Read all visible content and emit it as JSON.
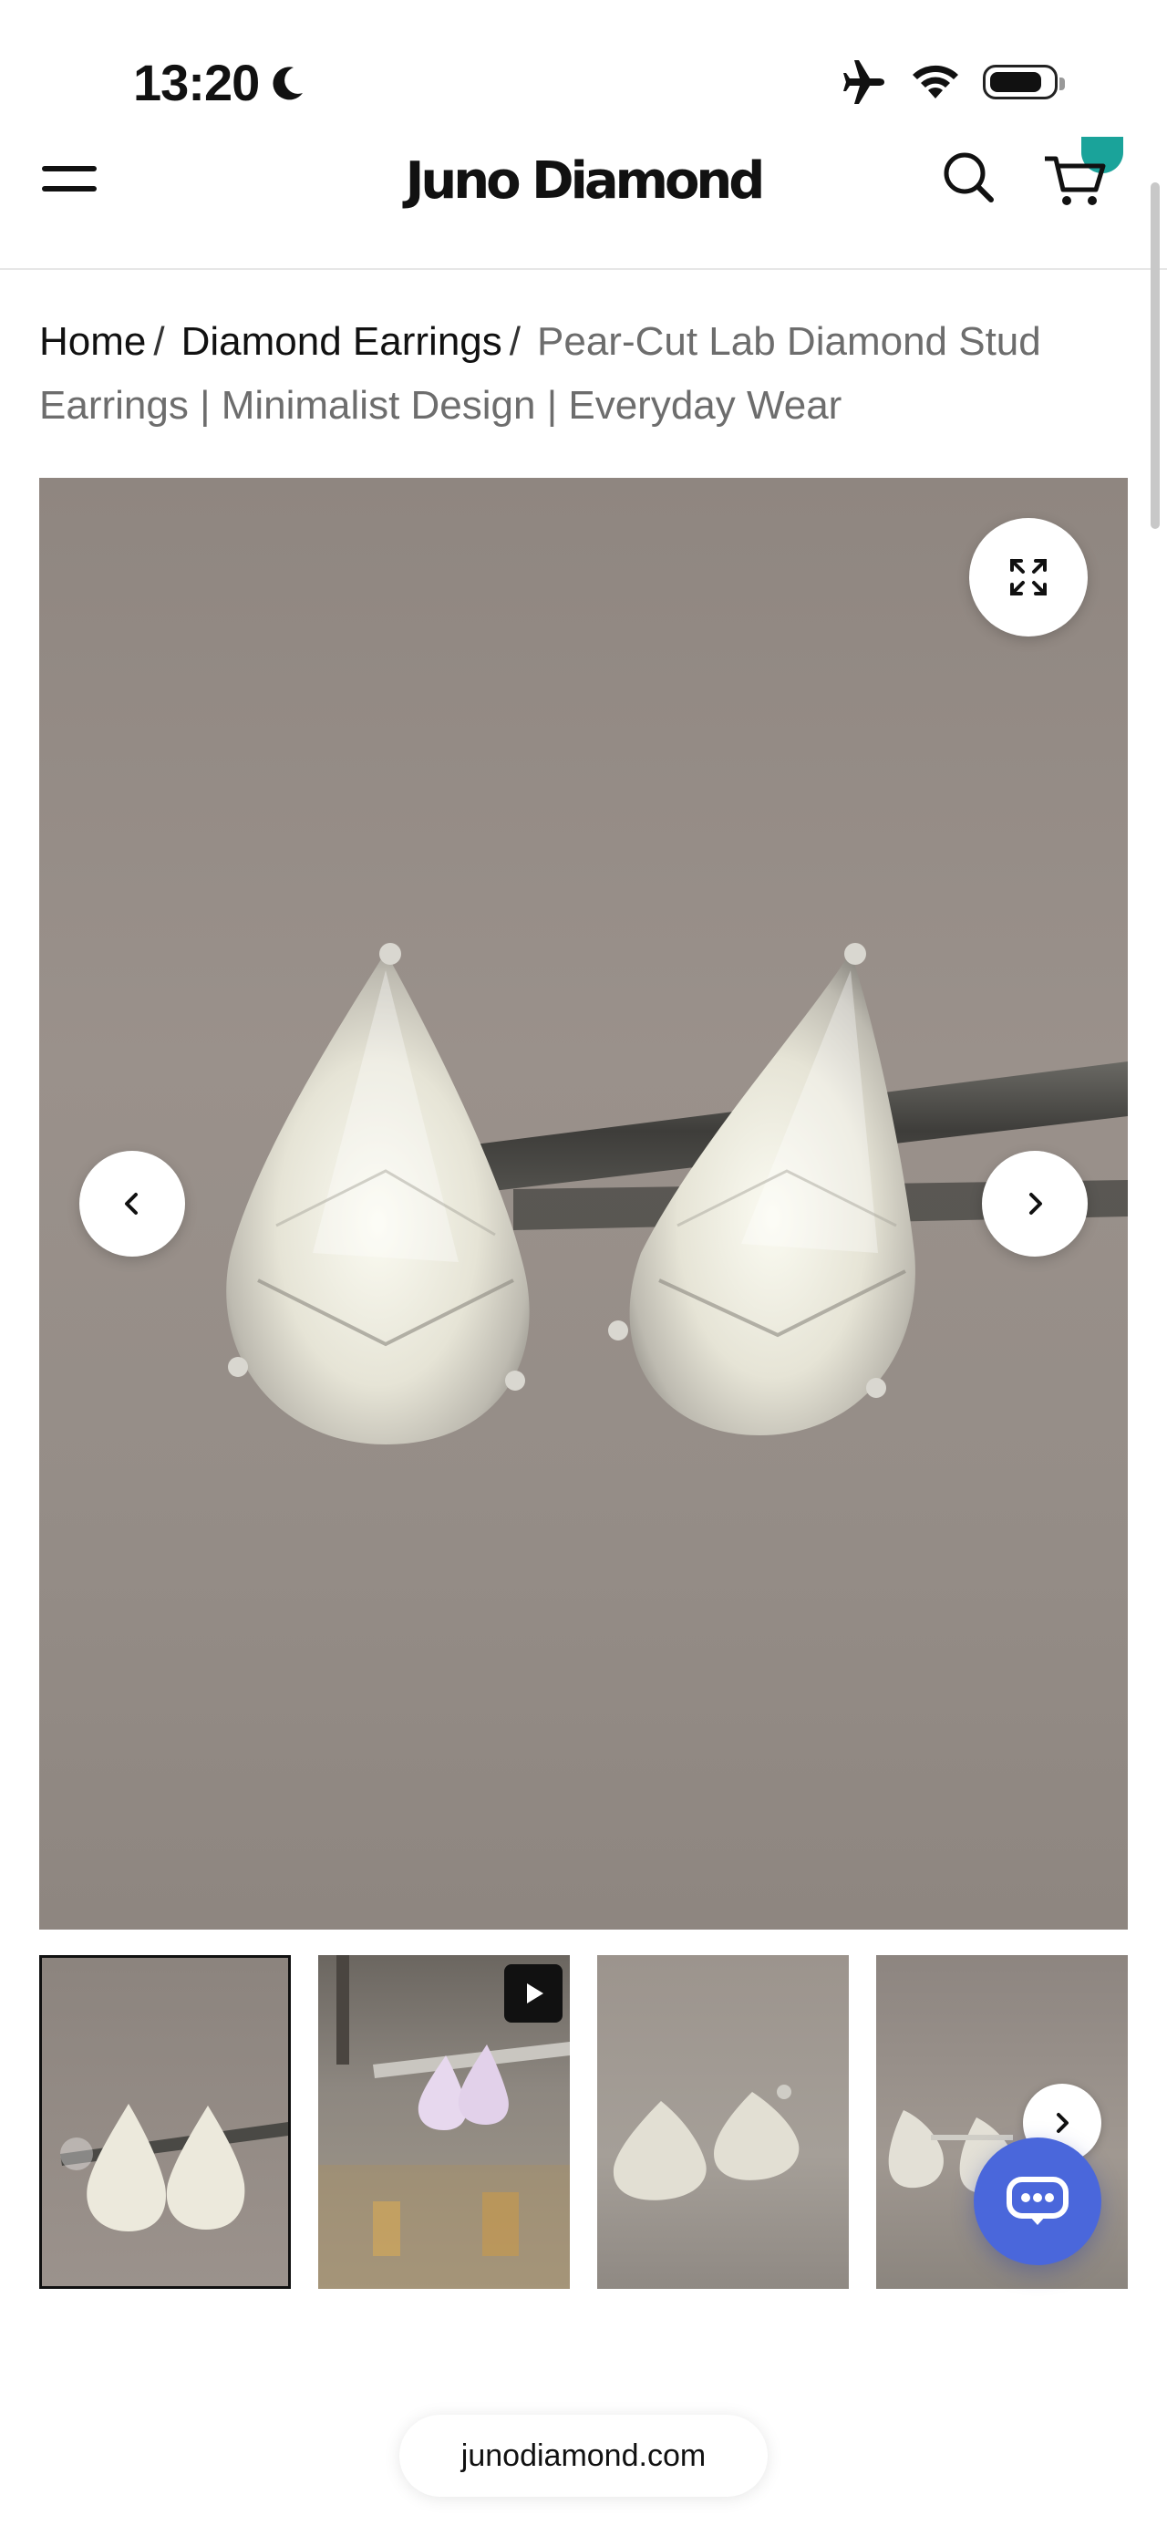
{
  "status_bar": {
    "time": "13:20",
    "icons": [
      "moon-icon",
      "airplane-icon",
      "wifi-icon",
      "battery-icon"
    ]
  },
  "header": {
    "brand": "Juno Diamond",
    "icons": [
      "menu-icon",
      "search-icon",
      "cart-icon"
    ],
    "accent_color": "#1aa39a"
  },
  "breadcrumb": {
    "items": [
      "Home",
      "Diamond Earrings"
    ],
    "separator": "/",
    "current": "Pear-Cut Lab Diamond Stud Earrings | Minimalist Design | Everyday Wear"
  },
  "gallery": {
    "main_image_alt": "pear-cut diamond stud earrings",
    "controls": [
      "expand-icon",
      "chevron-left-icon",
      "chevron-right-icon"
    ],
    "thumbnails": [
      {
        "kind": "image",
        "active": true
      },
      {
        "kind": "video",
        "active": false
      },
      {
        "kind": "image",
        "active": false
      },
      {
        "kind": "image",
        "active": false
      }
    ]
  },
  "chat": {
    "icon": "chat-bot-icon",
    "color": "#4a67db"
  },
  "browser": {
    "url": "junodiamond.com"
  }
}
